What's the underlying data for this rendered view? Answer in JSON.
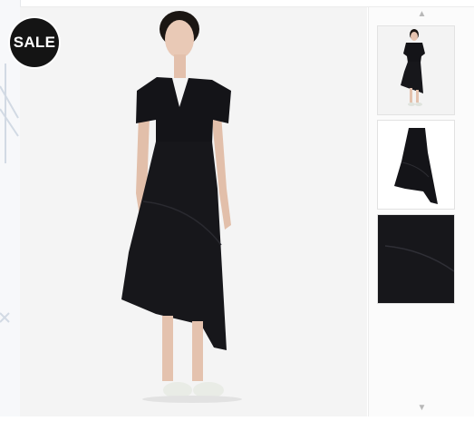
{
  "badge": {
    "label": "SALE"
  },
  "gallery": {
    "main_image": {
      "icon": "model-black-skirt-image"
    },
    "thumbnails": [
      {
        "icon": "thumbnail-full-outfit-image"
      },
      {
        "icon": "thumbnail-skirt-only-image"
      },
      {
        "icon": "thumbnail-skirt-detail-image"
      }
    ],
    "scroll_up": "▲",
    "scroll_down": "▼"
  },
  "colors": {
    "badge_bg": "#141414",
    "badge_text": "#ffffff",
    "garment": "#141418"
  }
}
